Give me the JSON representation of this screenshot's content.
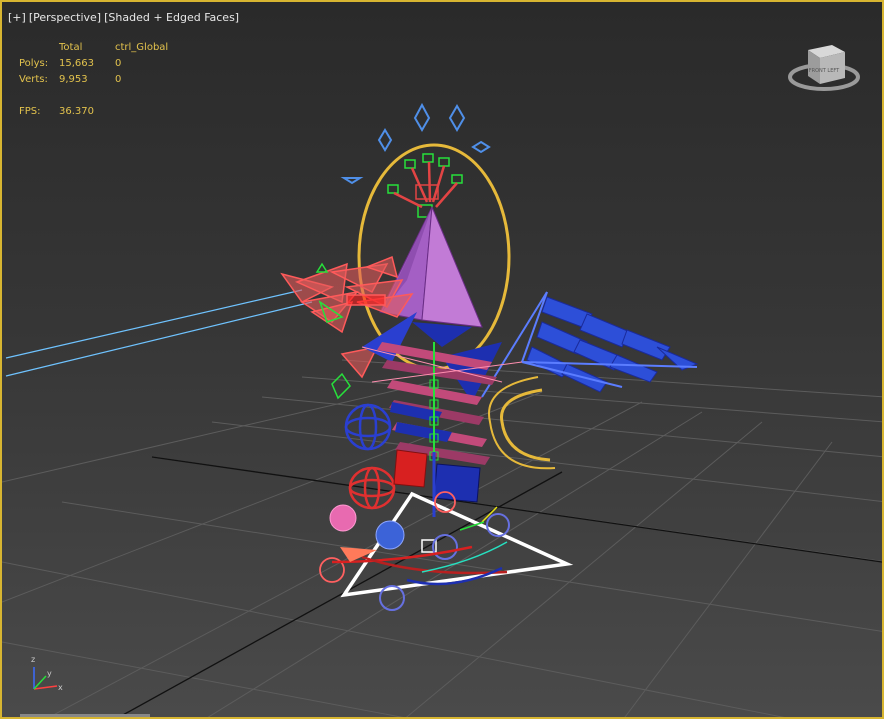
{
  "viewport": {
    "label": [
      "[+]",
      "[Perspective]",
      "[Shaded + Edged Faces]"
    ],
    "stats": {
      "headers": [
        "Total",
        "ctrl_Global"
      ],
      "rows": [
        {
          "label": "Polys:",
          "total": "15,663",
          "selected": "0"
        },
        {
          "label": "Verts:",
          "total": "9,953",
          "selected": "0"
        }
      ],
      "fps_label": "FPS:",
      "fps_value": "36.370"
    },
    "viewcube_face": "FRONT LEFT",
    "axis_labels": {
      "z": "z",
      "x": "x",
      "y": "y"
    }
  },
  "colors": {
    "border": "#d7b531",
    "stats_text": "#e2c24d",
    "grid": "#5a5a5a",
    "rig_yellow": "#e6b93a",
    "rig_red": "#e34444",
    "rig_blue": "#2a3fd0",
    "rig_pink": "#d85a8a",
    "rig_purple": "#b060c8"
  }
}
